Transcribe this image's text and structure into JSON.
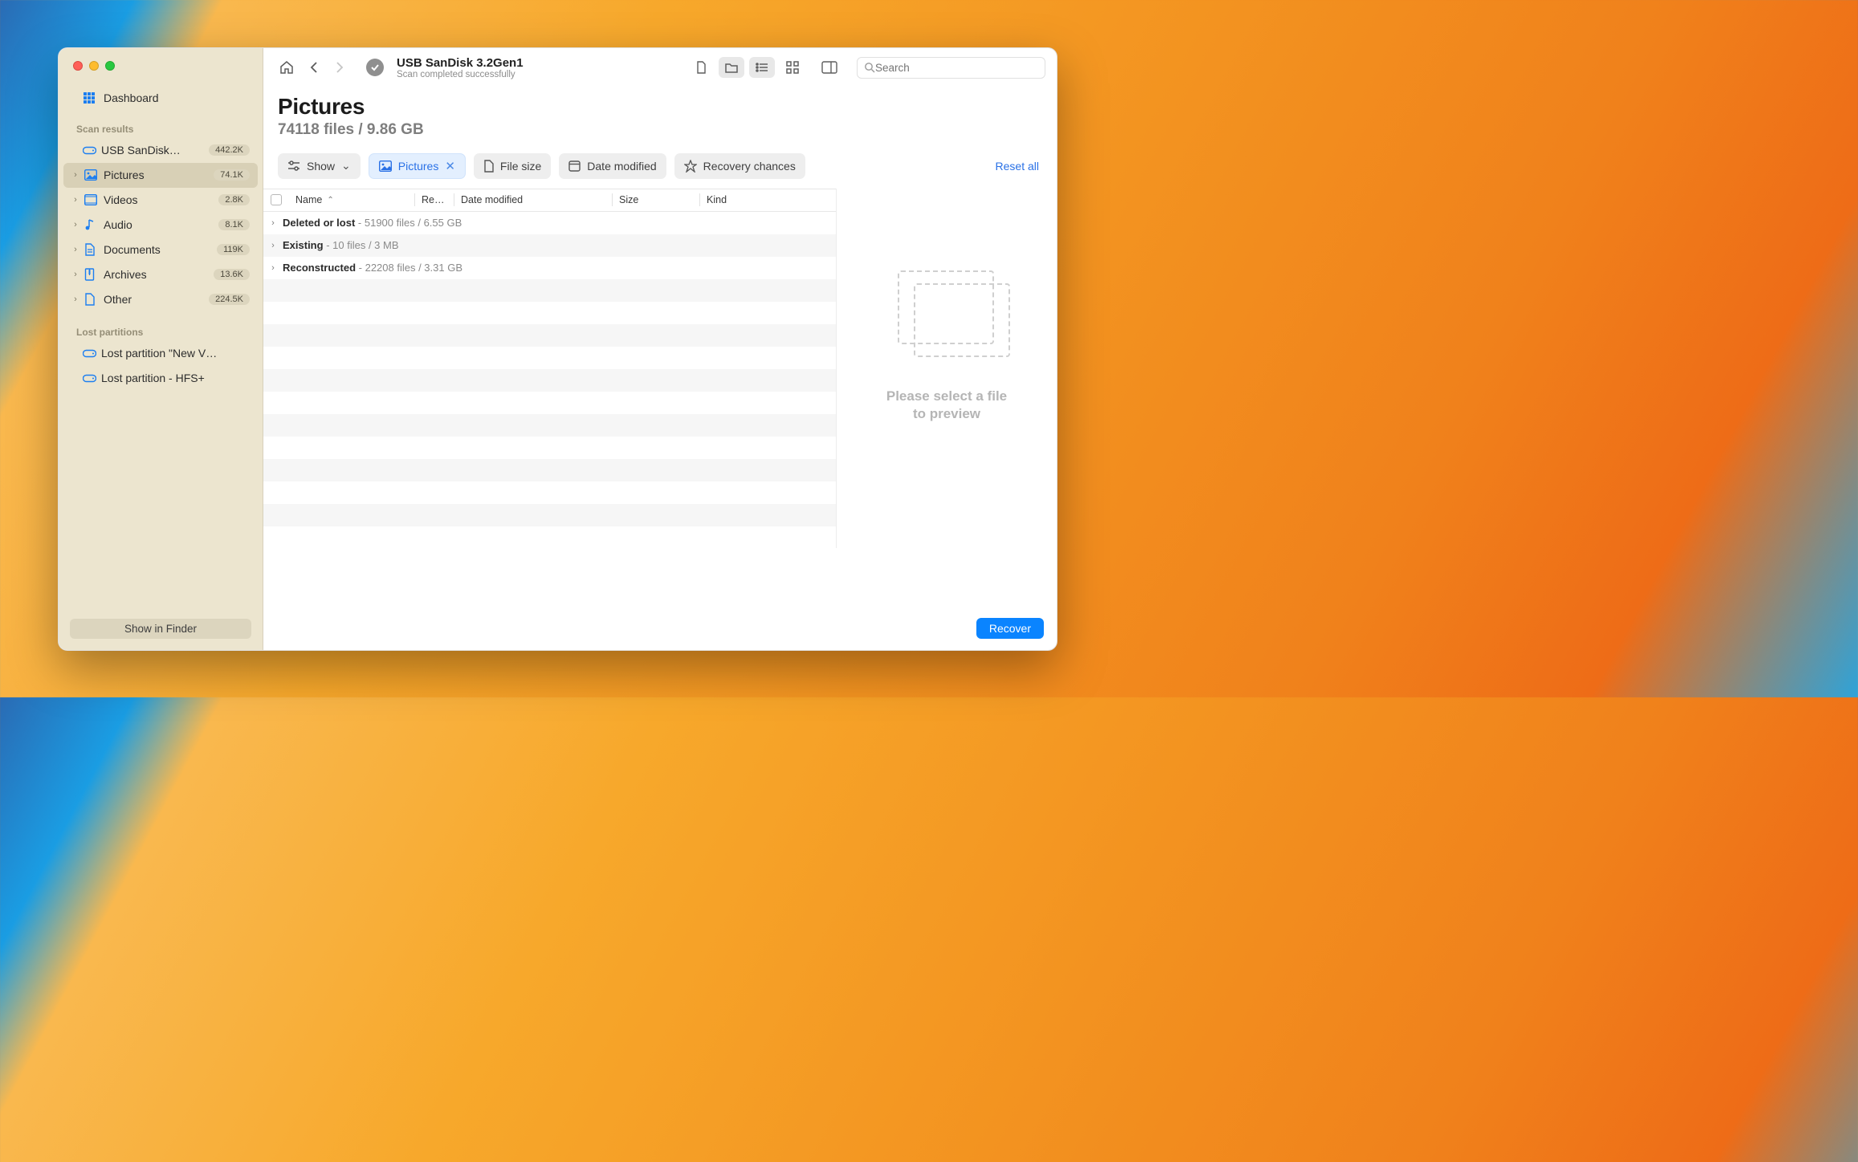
{
  "window": {
    "title": "USB  SanDisk 3.2Gen1",
    "subtitle": "Scan completed successfully"
  },
  "sidebar": {
    "dashboard": "Dashboard",
    "scan_results_label": "Scan results",
    "device": {
      "label": "USB  SanDisk…",
      "count": "442.2K"
    },
    "categories": [
      {
        "label": "Pictures",
        "count": "74.1K",
        "icon": "image"
      },
      {
        "label": "Videos",
        "count": "2.8K",
        "icon": "video"
      },
      {
        "label": "Audio",
        "count": "8.1K",
        "icon": "music"
      },
      {
        "label": "Documents",
        "count": "119K",
        "icon": "doc"
      },
      {
        "label": "Archives",
        "count": "13.6K",
        "icon": "archive"
      },
      {
        "label": "Other",
        "count": "224.5K",
        "icon": "file"
      }
    ],
    "lost_partitions_label": "Lost partitions",
    "lost_partitions": [
      {
        "label": "Lost partition \"New V…"
      },
      {
        "label": "Lost partition - HFS+"
      }
    ],
    "show_in_finder": "Show in Finder"
  },
  "header": {
    "title": "Pictures",
    "subtitle": "74118 files / 9.86 GB"
  },
  "filters": {
    "show": "Show",
    "pictures": "Pictures",
    "file_size": "File size",
    "date_modified": "Date modified",
    "recovery_chances": "Recovery chances",
    "reset_all": "Reset all"
  },
  "table": {
    "cols": {
      "name": "Name",
      "res": "Re…es",
      "date": "Date modified",
      "size": "Size",
      "kind": "Kind"
    },
    "rows": [
      {
        "label": "Deleted or lost",
        "meta": "51900 files / 6.55 GB"
      },
      {
        "label": "Existing",
        "meta": "10 files / 3 MB"
      },
      {
        "label": "Reconstructed",
        "meta": "22208 files / 3.31 GB"
      }
    ]
  },
  "preview": {
    "line1": "Please select a file",
    "line2": "to preview"
  },
  "footer": {
    "recover": "Recover"
  },
  "search": {
    "placeholder": "Search"
  }
}
